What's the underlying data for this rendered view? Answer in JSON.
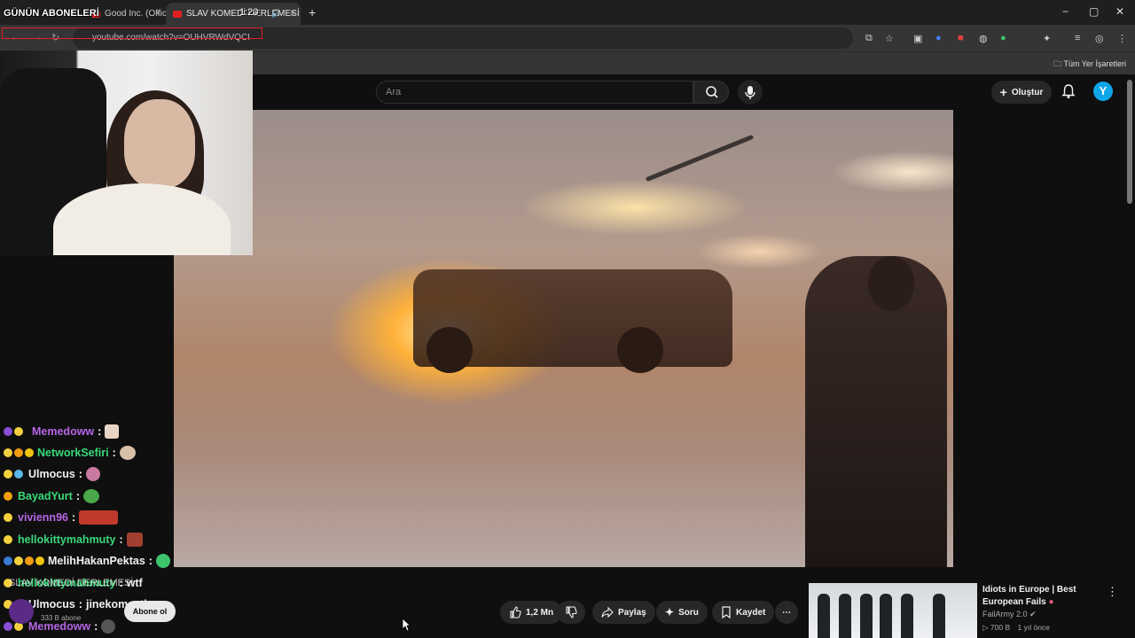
{
  "browser": {
    "tabs": [
      {
        "title": "Good Inc. (Offici"
      },
      {
        "title": "SLAV KOMEDİ DERLEMESİ"
      }
    ],
    "tab_count": "1:20",
    "url": "youtube.com/watch?v=OUHVRWdVQCI",
    "bookmark_folder": "Tüm Yer İşaretleri",
    "new_tab": "+",
    "close": "×",
    "min": "−",
    "max": "▢",
    "winclose": "✕"
  },
  "overlay": {
    "title": "GÜNÜN ABONELERİ"
  },
  "youtube": {
    "search_placeholder": "Ara",
    "create_label": "Oluştur",
    "avatar_letter": "Y",
    "actions": {
      "likes": "1,2 Mn",
      "share": "Paylaş",
      "ask": "Soru",
      "save": "Kaydet"
    },
    "channel": {
      "subs": "333 B abone",
      "subscribe": "Abone ol"
    },
    "recommendation": {
      "title": "Idiots in Europe | Best European Fails",
      "channel": "FailArmy 2.0",
      "views": "700 B",
      "age": "1 yıl önce"
    }
  },
  "chat": [
    {
      "user": "Memedoww",
      "color": "#b565e6"
    },
    {
      "user": "NetworkSefiri",
      "color": "#38d97a"
    },
    {
      "user": "Ulmocus",
      "color": "#f1f1f1"
    },
    {
      "user": "BayadYurt",
      "color": "#38d97a"
    },
    {
      "user": "vivienn96",
      "color": "#b565e6"
    },
    {
      "user": "hellokittymahmuty",
      "color": "#38d97a"
    },
    {
      "user": "MelihHakanPektas",
      "color": "#f1f1f1"
    },
    {
      "user": "hellokittymahmuty",
      "color": "#38d97a",
      "text": "wtf"
    },
    {
      "user": "Ulmocus",
      "color": "#f1f1f1",
      "text": "jinekomasti"
    },
    {
      "user": "Memedoww",
      "color": "#b565e6"
    }
  ],
  "chat_sep": ":",
  "chat_overlap_text": "SLAV KOMEDİ DERLEMESİ",
  "colors": {
    "accent_red": "#e0202a",
    "yt_blue": "#0ea5e9"
  }
}
